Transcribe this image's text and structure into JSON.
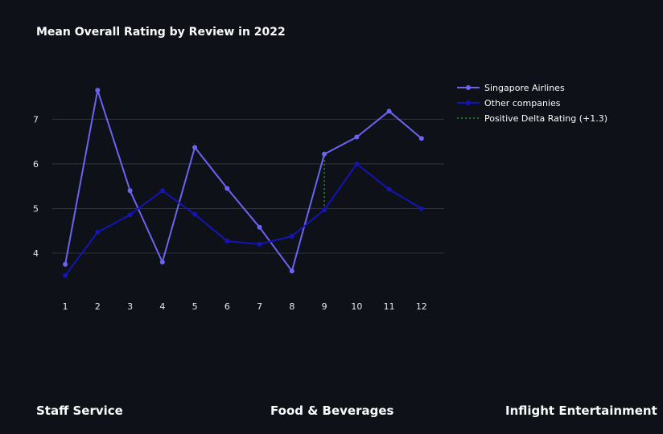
{
  "chart_data": {
    "type": "line",
    "title": "Mean Overall Rating by Review in 2022",
    "xlabel": "",
    "ylabel": "",
    "x": [
      1,
      2,
      3,
      4,
      5,
      6,
      7,
      8,
      9,
      10,
      11,
      12
    ],
    "x_ticks": [
      "1",
      "2",
      "3",
      "4",
      "5",
      "6",
      "7",
      "8",
      "9",
      "10",
      "11",
      "12"
    ],
    "y_ticks": [
      "4",
      "5",
      "6",
      "7"
    ],
    "y_tick_values": [
      4,
      5,
      6,
      7
    ],
    "xlim": [
      0.6,
      12.7
    ],
    "ylim": [
      3.1,
      8.05
    ],
    "grid": "horizontal",
    "legend_position": "top-right",
    "series": [
      {
        "name": "Singapore Airlines",
        "color": "#6c63f0",
        "marker": "circle",
        "values": [
          3.75,
          7.65,
          5.4,
          3.8,
          6.37,
          5.45,
          4.58,
          3.6,
          6.22,
          6.6,
          7.18,
          6.57
        ]
      },
      {
        "name": "Other companies",
        "color": "#1414b8",
        "marker": "circle",
        "values": [
          3.5,
          4.47,
          4.86,
          5.4,
          4.87,
          4.27,
          4.2,
          4.38,
          4.97,
          6.0,
          5.43,
          5.0
        ]
      }
    ],
    "annotations": [
      {
        "name": "Positive Delta Rating (+1.3)",
        "type": "dotted-vertical-line",
        "color": "#1f9a1f",
        "x": 9,
        "y_from": 4.97,
        "y_to": 6.22
      }
    ]
  },
  "sections": {
    "staff_service": "Staff Service",
    "food_beverages": "Food & Beverages",
    "inflight_entertainment": "Inflight Entertainment"
  }
}
